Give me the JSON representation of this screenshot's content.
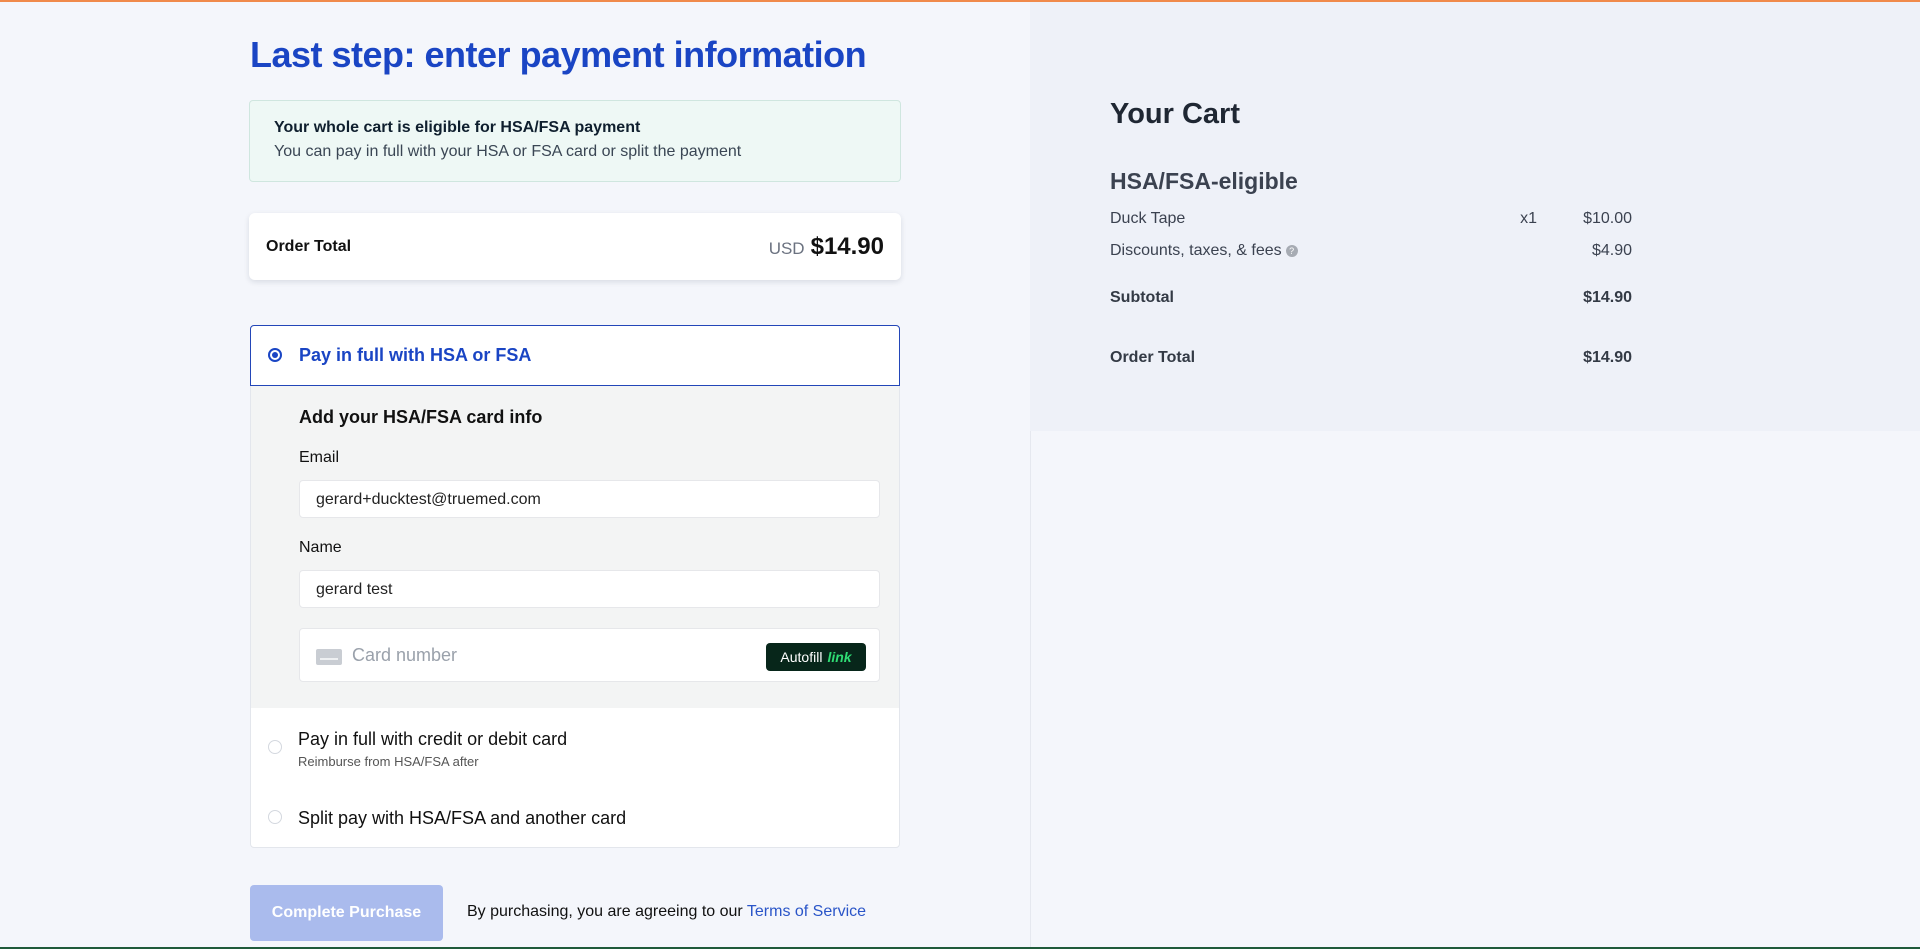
{
  "page": {
    "title": "Last step: enter payment information"
  },
  "eligibility": {
    "heading": "Your whole cart is eligible for HSA/FSA payment",
    "subtext": "You can pay in full with your HSA or FSA card or split the payment"
  },
  "order_total": {
    "label": "Order Total",
    "currency": "USD",
    "amount": "$14.90"
  },
  "payment_options": {
    "hsa_full": {
      "label": "Pay in full with HSA or FSA",
      "selected": true
    },
    "card_info": {
      "title": "Add your HSA/FSA card info",
      "email_label": "Email",
      "email_value": "gerard+ducktest@truemed.com",
      "name_label": "Name",
      "name_value": "gerard test",
      "card_placeholder": "Card number",
      "autofill_text": "Autofill",
      "autofill_brand": "link"
    },
    "credit_full": {
      "label": "Pay in full with credit or debit card",
      "sublabel": "Reimburse from HSA/FSA after"
    },
    "split": {
      "label": "Split pay with HSA/FSA and another card"
    }
  },
  "footer": {
    "button_label": "Complete Purchase",
    "agree_text": "By purchasing, you are agreeing to our",
    "terms_link": "Terms of Service"
  },
  "cart": {
    "title": "Your Cart",
    "section": "HSA/FSA-eligible",
    "items": [
      {
        "name": "Duck Tape",
        "qty": "x1",
        "price": "$10.00"
      }
    ],
    "fees": {
      "label": "Discounts, taxes, & fees",
      "amount": "$4.90",
      "help_glyph": "?"
    },
    "subtotal": {
      "label": "Subtotal",
      "amount": "$14.90"
    },
    "order_total": {
      "label": "Order Total",
      "amount": "$14.90"
    }
  },
  "colors": {
    "accent": "#1a45c4",
    "button_disabled": "#aabbed",
    "top_bar": "#f08a4b",
    "link_brand": "#2fdc74"
  }
}
